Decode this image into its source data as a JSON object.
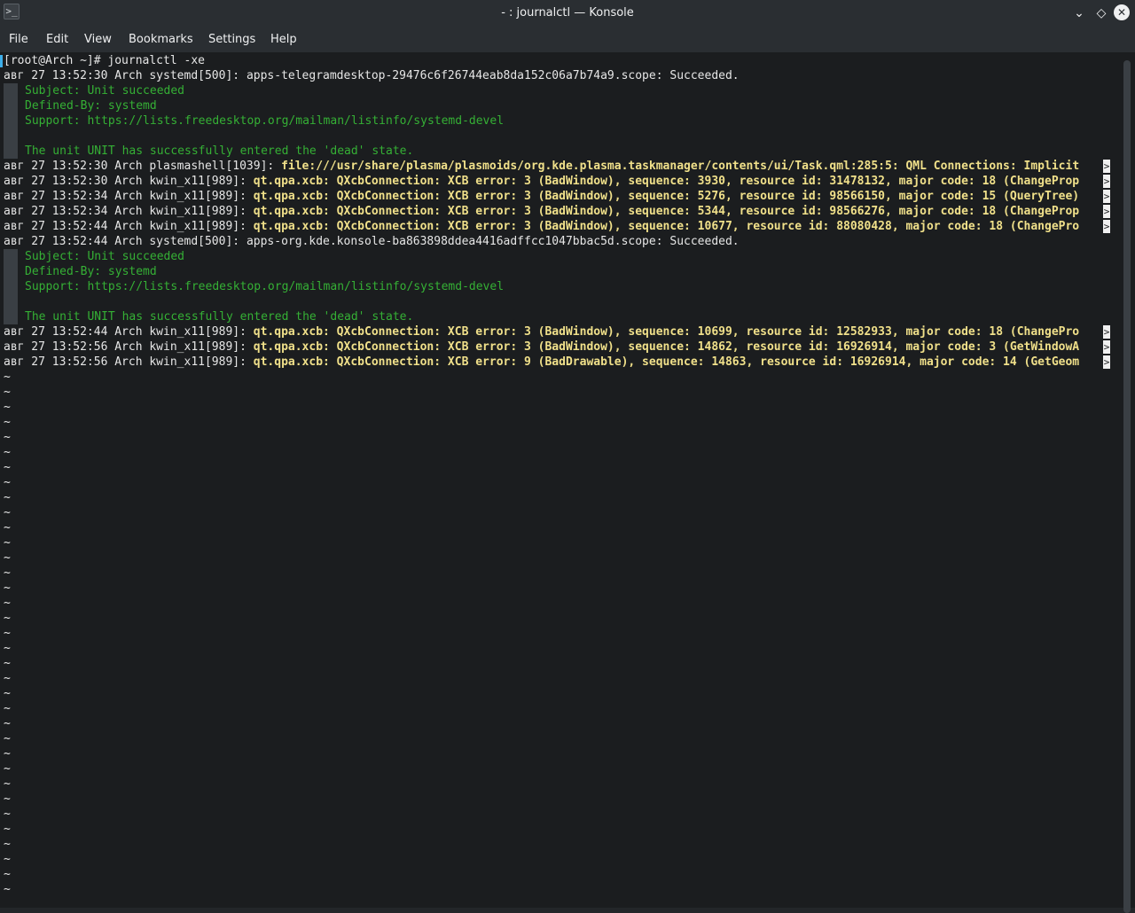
{
  "window": {
    "title": "- : journalctl — Konsole",
    "icon": "terminal-app-icon",
    "buttons": {
      "minimize": "chevron-down-icon",
      "maximize": "diamond-icon",
      "close": "close-icon"
    }
  },
  "menubar": {
    "file": "File",
    "edit": "Edit",
    "view": "View",
    "bookmarks": "Bookmarks",
    "settings": "Settings",
    "help": "Help"
  },
  "colors": {
    "background": "#1b1d1f",
    "chrome": "#2a2e32",
    "text": "#e6e6e6",
    "green": "#35b035",
    "yellow": "#f0e08a",
    "accent": "#3daee9"
  },
  "terminal": {
    "prompt": "[root@Arch ~]# journalctl -xe",
    "lines": [
      {
        "prefix": "авг 27 13:52:30 Arch systemd[500]: ",
        "message": "apps-telegramdesktop-29476c6f26744eab8da152c06a7b74a9.scope: Succeeded."
      },
      {
        "detail": "Subject: Unit succeeded"
      },
      {
        "detail": "Defined-By: systemd"
      },
      {
        "detail": "Support: https://lists.freedesktop.org/mailman/listinfo/systemd-devel"
      },
      {
        "detail": ""
      },
      {
        "detail": "The unit UNIT has successfully entered the 'dead' state."
      },
      {
        "prefix": "авг 27 13:52:30 Arch plasmashell[1039]: ",
        "highlight": "file:///usr/share/plasma/plasmoids/org.kde.plasma.taskmanager/contents/ui/Task.qml:285:5: QML Connections: Implicit"
      },
      {
        "prefix": "авг 27 13:52:30 Arch kwin_x11[989]: ",
        "highlight": "qt.qpa.xcb: QXcbConnection: XCB error: 3 (BadWindow), sequence: 3930, resource id: 31478132, major code: 18 (ChangeProp"
      },
      {
        "prefix": "авг 27 13:52:34 Arch kwin_x11[989]: ",
        "highlight": "qt.qpa.xcb: QXcbConnection: XCB error: 3 (BadWindow), sequence: 5276, resource id: 98566150, major code: 15 (QueryTree)"
      },
      {
        "prefix": "авг 27 13:52:34 Arch kwin_x11[989]: ",
        "highlight": "qt.qpa.xcb: QXcbConnection: XCB error: 3 (BadWindow), sequence: 5344, resource id: 98566276, major code: 18 (ChangeProp"
      },
      {
        "prefix": "авг 27 13:52:44 Arch kwin_x11[989]: ",
        "highlight": "qt.qpa.xcb: QXcbConnection: XCB error: 3 (BadWindow), sequence: 10677, resource id: 88080428, major code: 18 (ChangePro"
      },
      {
        "prefix": "авг 27 13:52:44 Arch systemd[500]: ",
        "message": "apps-org.kde.konsole-ba863898ddea4416adffcc1047bbac5d.scope: Succeeded."
      },
      {
        "detail": "Subject: Unit succeeded"
      },
      {
        "detail": "Defined-By: systemd"
      },
      {
        "detail": "Support: https://lists.freedesktop.org/mailman/listinfo/systemd-devel"
      },
      {
        "detail": ""
      },
      {
        "detail": "The unit UNIT has successfully entered the 'dead' state."
      },
      {
        "prefix": "авг 27 13:52:44 Arch kwin_x11[989]: ",
        "highlight": "qt.qpa.xcb: QXcbConnection: XCB error: 3 (BadWindow), sequence: 10699, resource id: 12582933, major code: 18 (ChangePro"
      },
      {
        "prefix": "авг 27 13:52:56 Arch kwin_x11[989]: ",
        "highlight": "qt.qpa.xcb: QXcbConnection: XCB error: 3 (BadWindow), sequence: 14862, resource id: 16926914, major code: 3 (GetWindowA"
      },
      {
        "prefix": "авг 27 13:52:56 Arch kwin_x11[989]: ",
        "highlight": "qt.qpa.xcb: QXcbConnection: XCB error: 9 (BadDrawable), sequence: 14863, resource id: 16926914, major code: 14 (GetGeom"
      }
    ],
    "truncation_marker": ">",
    "filler": "~",
    "filler_count": 35
  }
}
